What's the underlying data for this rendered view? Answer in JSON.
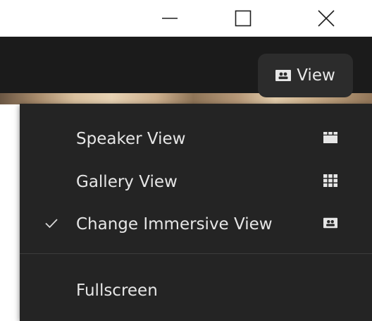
{
  "window": {
    "minimize_icon": "minimize-icon",
    "maximize_icon": "maximize-icon",
    "close_icon": "close-icon"
  },
  "toolbar": {
    "view_button_label": "View",
    "view_button_icon": "immersive-view-icon"
  },
  "view_menu": {
    "items": [
      {
        "label": "Speaker View",
        "icon": "speaker-view-icon",
        "checked": false
      },
      {
        "label": "Gallery View",
        "icon": "gallery-view-icon",
        "checked": false
      },
      {
        "label": "Change Immersive View",
        "icon": "immersive-view-icon",
        "checked": true
      }
    ],
    "secondary_items": [
      {
        "label": "Fullscreen"
      }
    ]
  },
  "colors": {
    "titlebar_bg": "#ffffff",
    "toolbar_bg": "#1b1b1b",
    "menu_bg": "#242424",
    "menu_text": "#e6e6e6",
    "view_button_bg": "#2c2c2c"
  }
}
